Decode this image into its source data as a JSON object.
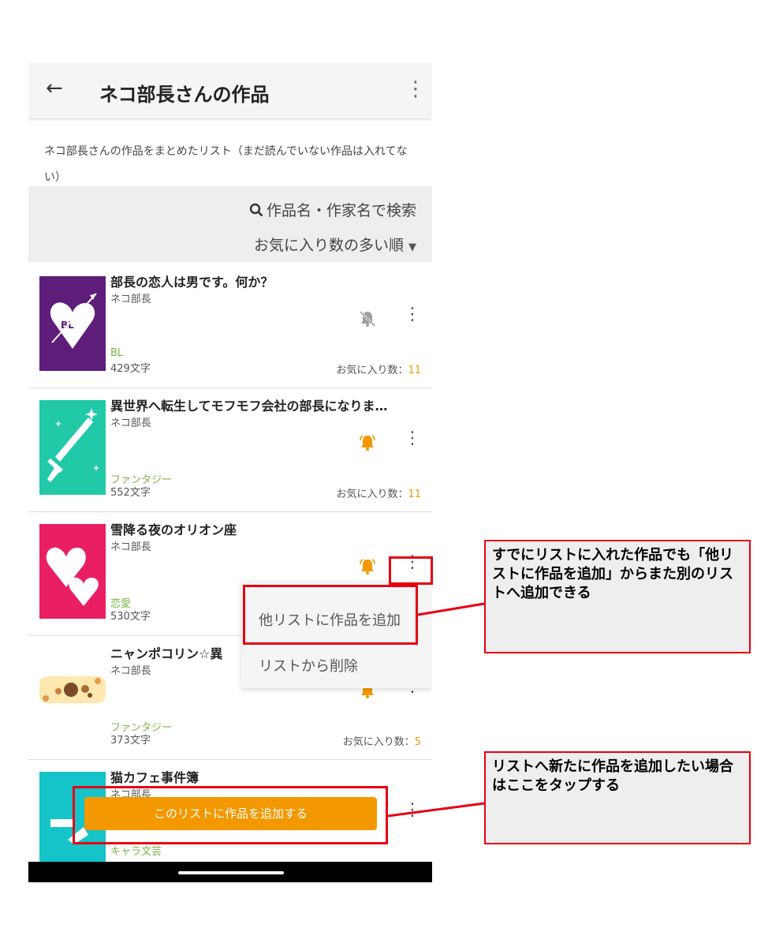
{
  "appbar": {
    "title": "ネコ部長さんの作品",
    "back_icon": "←",
    "menu_icon": "⋮"
  },
  "description": "ネコ部長さんの作品をまとめたリスト（まだ読んでいない作品は入れてない）",
  "filters": {
    "search_label": "作品名・作家名で検索",
    "sort_label": "お気に入り数の多い順"
  },
  "fav_prefix": "お気に入り数：",
  "works": [
    {
      "title": "部長の恋人は男です。何か？",
      "author": "ネコ部長",
      "genre": "BL",
      "chars": "429文字",
      "favorites": "11",
      "bell": "off"
    },
    {
      "title": "異世界へ転生してモフモフ会社の部長になりま…",
      "author": "ネコ部長",
      "genre": "ファンタジー",
      "chars": "552文字",
      "favorites": "11",
      "bell": "on"
    },
    {
      "title": "雪降る夜のオリオン座",
      "author": "ネコ部長",
      "genre": "恋愛",
      "chars": "530文字",
      "favorites": "",
      "bell": "on"
    },
    {
      "title": "ニャンポコリン☆異",
      "author": "ネコ部長",
      "genre": "ファンタジー",
      "chars": "373文字",
      "favorites": "5",
      "bell": "on"
    },
    {
      "title": "猫カフェ事件簿",
      "author": "ネコ部長",
      "genre": "キャラ文芸",
      "chars": "",
      "favorites": "",
      "bell": "on"
    }
  ],
  "popup_menu": {
    "items": [
      "他リストに作品を追加",
      "リストから削除"
    ]
  },
  "add_button": "このリストに作品を追加する",
  "callouts": {
    "top": "すでにリストに入れた作品でも「他リストに作品を追加」からまた別のリストへ追加できる",
    "bottom": "リストへ新たに作品を追加したい場合はここをタップする"
  },
  "colors": {
    "accent": "#f39800",
    "annotation_red": "#e60012",
    "genre_green": "#7cb342"
  }
}
